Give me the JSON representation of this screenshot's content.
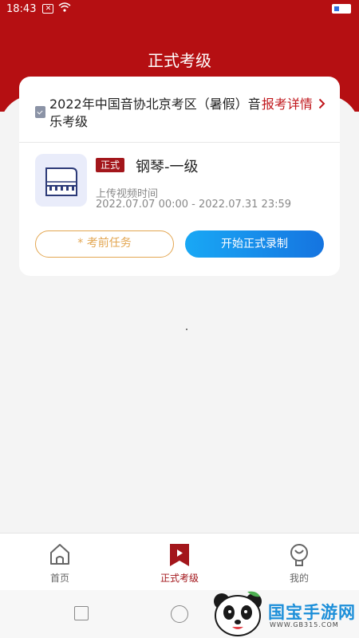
{
  "status_bar": {
    "time": "18:43"
  },
  "header": {
    "title": "正式考级"
  },
  "exam": {
    "name": "2022年中国音协北京考区（暑假）音乐考级",
    "detail_link": "报考详情",
    "badge": "正式",
    "subject": "钢琴-一级",
    "upload_label": "上传视频时间",
    "upload_range": "2022.07.07 00:00 - 2022.07.31 23:59",
    "task_button": "* 考前任务",
    "record_button": "开始正式录制"
  },
  "tabbar": {
    "tabs": [
      {
        "label": "首页",
        "icon": "home-icon"
      },
      {
        "label": "正式考级",
        "icon": "exam-flag-icon",
        "active": true
      },
      {
        "label": "我的",
        "icon": "profile-icon"
      }
    ],
    "active_color": "#a3161b"
  },
  "watermark": {
    "text": "国宝手游网",
    "url": "WWW.GB315.COM"
  },
  "colors": {
    "brand_red": "#b50f12",
    "record_blue": "#1574e0",
    "task_orange": "#e3a651"
  }
}
